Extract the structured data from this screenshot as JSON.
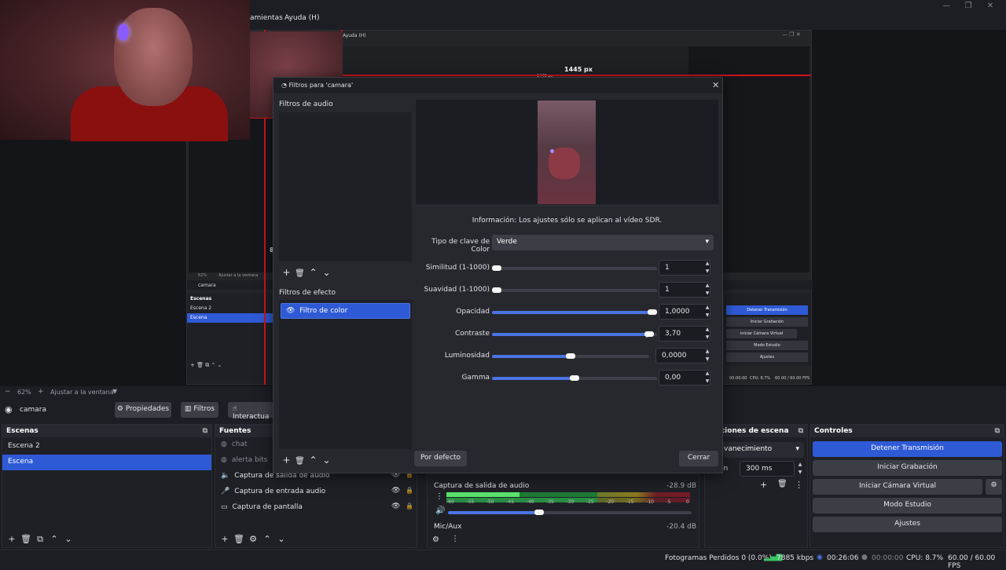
{
  "menu": {
    "items": [
      "amientas",
      "Ayuda (H)"
    ]
  },
  "nested": {
    "measure": "1445 px",
    "measure_small": "1445 px",
    "side_marker": "8",
    "menu_help": "Ayuda (H)",
    "zoom_pct": "62%",
    "zoom_fit": "Ajustar a la ventana",
    "source_name": "camara",
    "scenes_title": "Escenas",
    "scenes": [
      "Escena 2",
      "Escena"
    ],
    "controls": [
      "Detener Transmisión",
      "Iniciar Grabación",
      "iniciar Cámara Virtual",
      "Modo Estudio",
      "Ajustes"
    ],
    "status": "CPU: 8.7%",
    "fps": "60.00 / 60.00 FPS",
    "rec_time": "00:00:00"
  },
  "zoom": {
    "pct": "62%",
    "fit": "Ajustar a la ventana"
  },
  "source_bar": {
    "name": "camara",
    "properties": "Propiedades",
    "filters": "Filtros",
    "interact": "Interactua"
  },
  "scenes": {
    "title": "Escenas",
    "items": [
      {
        "label": "Escena 2",
        "selected": false
      },
      {
        "label": "Escena",
        "selected": true
      }
    ]
  },
  "sources": {
    "title": "Fuentes",
    "items": [
      {
        "label": "chat",
        "icon": "browser-icon",
        "visible_controls": false,
        "dim": true
      },
      {
        "label": "alerta bits",
        "icon": "browser-icon",
        "visible_controls": false,
        "dim": true
      },
      {
        "label": "Captura de salida de audio",
        "icon": "speaker-icon",
        "visible_controls": true,
        "dim": false
      },
      {
        "label": "Captura de entrada audio",
        "icon": "microphone-icon",
        "visible_controls": true,
        "dim": false
      },
      {
        "label": "Captura de pantalla",
        "icon": "monitor-icon",
        "visible_controls": true,
        "dim": false
      }
    ]
  },
  "mixer": {
    "channels": [
      {
        "name": "Captura de salida de audio",
        "db": "-28.9 dB"
      },
      {
        "name": "Mic/Aux",
        "db": "-20.4 dB"
      }
    ],
    "ticks": [
      "-60",
      "-55",
      "-50",
      "-45",
      "-40",
      "-35",
      "-30",
      "-25",
      "-20",
      "-15",
      "-10",
      "-5",
      "0"
    ]
  },
  "transitions": {
    "title": "nsiciones de escena",
    "type": "vanecimiento",
    "duration_label": "ón",
    "duration": "300 ms"
  },
  "controls": {
    "title": "Controles",
    "buttons": [
      {
        "label": "Detener Transmisión",
        "active": true
      },
      {
        "label": "Iniciar Grabación",
        "active": false
      },
      {
        "label": "Iniciar Cámara Virtual",
        "active": false
      },
      {
        "label": "Modo Estudio",
        "active": false
      },
      {
        "label": "Ajustes",
        "active": false
      }
    ]
  },
  "status": {
    "frames": "Fotogramas Perdidos 0 (0.0%)",
    "kbps": "7885 kbps",
    "live_time": "00:26:06",
    "rec_time": "00:00:00",
    "cpu": "CPU: 8.7%",
    "fps": "60.00 / 60.00 FPS"
  },
  "dialog": {
    "title": "Filtros para 'camara'",
    "audio_filters_title": "Filtros de audio",
    "effect_filters_title": "Filtros de efecto",
    "effect_filters": [
      "Filtro de color"
    ],
    "info": "Información: Los ajustes sólo se aplican al vídeo SDR.",
    "color_key_label": "Tipo de clave de Color",
    "color_key_value": "Verde",
    "properties": [
      {
        "label": "Similitud (1-1000)",
        "value": "1",
        "fraction": 0.0
      },
      {
        "label": "Suavidad (1-1000)",
        "value": "1",
        "fraction": 0.0
      },
      {
        "label": "Opacidad",
        "value": "1,0000",
        "fraction": 1.0
      },
      {
        "label": "Contraste",
        "value": "3,70",
        "fraction": 0.98
      },
      {
        "label": "Luminosidad",
        "value": "0,0000",
        "fraction": 0.5
      },
      {
        "label": "Gamma",
        "value": "0,00",
        "fraction": 0.5
      }
    ],
    "defaults_button": "Por defecto",
    "close_button": "Cerrar"
  },
  "colors": {
    "accent": "#2f5ad6",
    "panel": "#1f2026",
    "background": "#1d1e24",
    "red_guide": "#d0131a"
  }
}
